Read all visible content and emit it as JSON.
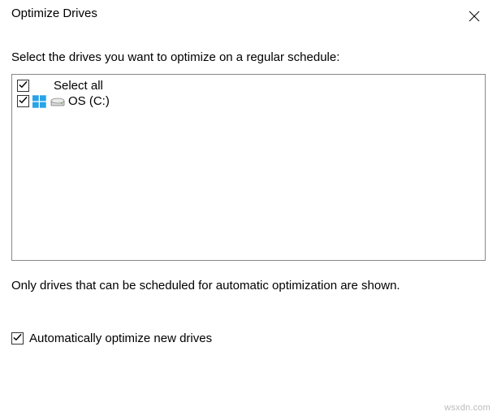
{
  "window": {
    "title": "Optimize Drives"
  },
  "main": {
    "prompt": "Select the drives you want to optimize on a regular schedule:",
    "select_all_label": "Select all",
    "drives": [
      {
        "label": "OS (C:)",
        "checked": true
      }
    ],
    "note": "Only drives that can be scheduled for automatic optimization are shown.",
    "auto_optimize_label": "Automatically optimize new drives",
    "auto_optimize_checked": true
  },
  "watermark": "wsxdn.com"
}
